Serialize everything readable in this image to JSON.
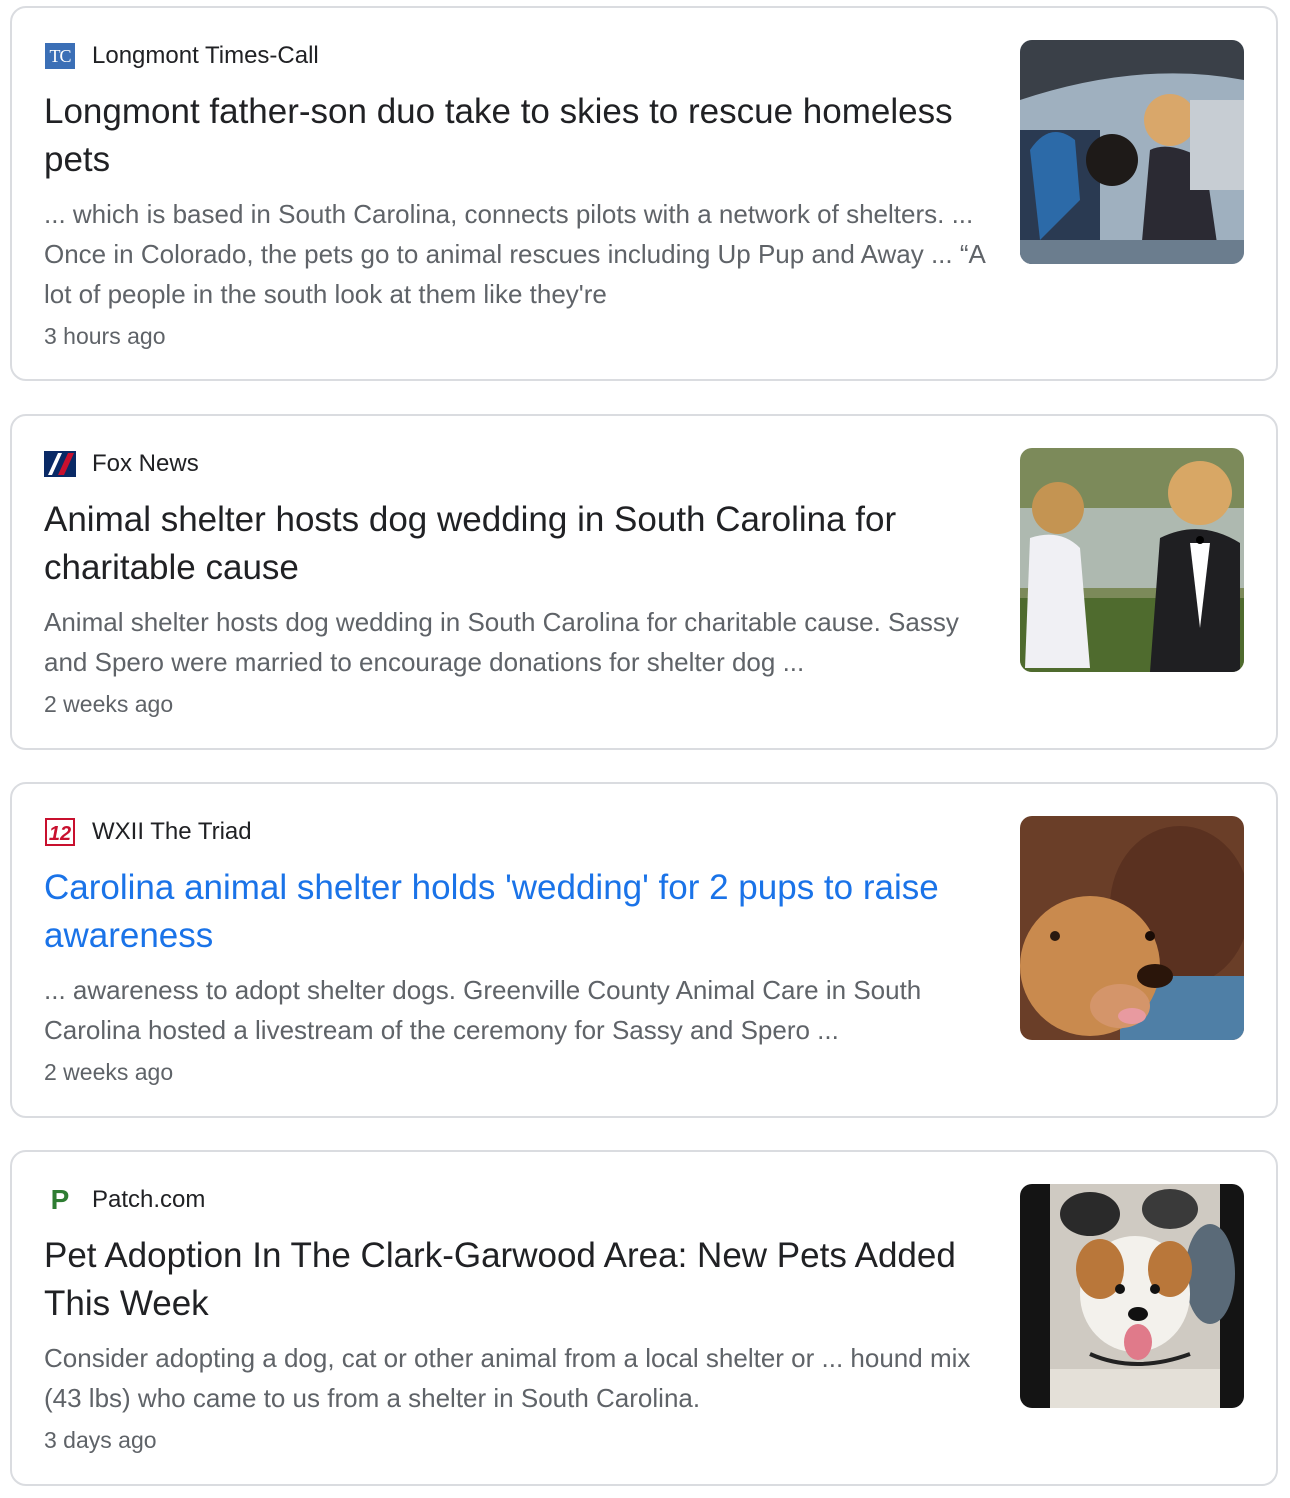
{
  "articles": [
    {
      "source": "Longmont Times-Call",
      "source_icon": "tc-logo-icon",
      "source_icon_text": "TC",
      "headline": "Longmont father-son duo take to skies to rescue homeless pets",
      "snippet": "... which is based in South Carolina, connects pilots with a network of shelters. ... Once in Colorado, the pets go to animal rescues including Up Pup and Away ... “A lot of people in the south look at them like they're",
      "time": "3 hours ago",
      "thumbnail": "plane-pilots-with-dog-thumbnail"
    },
    {
      "source": "Fox News",
      "source_icon": "fox-news-logo-icon",
      "headline": "Animal shelter hosts dog wedding in South Carolina for charitable cause",
      "snippet": "Animal shelter hosts dog wedding in South Carolina for charitable cause. Sassy and Spero were married to encourage donations for shelter dog ...",
      "time": "2 weeks ago",
      "thumbnail": "dog-wedding-thumbnail"
    },
    {
      "source": "WXII The Triad",
      "source_icon": "wxii-12-logo-icon",
      "source_icon_text": "12",
      "headline": "Carolina animal shelter holds 'wedding' for 2 pups to raise awareness",
      "snippet": "... awareness to adopt shelter dogs. Greenville County Animal Care in South Carolina hosted a livestream of the ceremony for Sassy and Spero ...",
      "time": "2 weeks ago",
      "thumbnail": "two-dogs-closeup-thumbnail"
    },
    {
      "source": "Patch.com",
      "source_icon": "patch-logo-icon",
      "source_icon_text": "P",
      "headline": "Pet Adoption In The Clark-Garwood Area: New Pets Added This Week",
      "snippet": "Consider adopting a dog, cat or other animal from a local shelter or ... hound mix (43 lbs) who came to us from a shelter in South Carolina.",
      "time": "3 days ago",
      "thumbnail": "hound-puppy-thumbnail"
    }
  ],
  "colors": {
    "headline": "#202124",
    "visited_headline": "#1a73e8",
    "snippet": "#5f6368",
    "border": "#dadce0"
  }
}
